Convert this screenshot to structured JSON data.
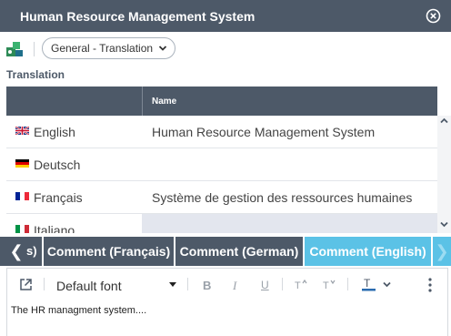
{
  "window": {
    "title": "Human Resource Management System"
  },
  "toolbar": {
    "view_selector": "General - Translation"
  },
  "translation": {
    "section_label": "Translation",
    "header_name": "Name",
    "rows": [
      {
        "flag": "uk-flag-icon",
        "language": "English",
        "value": "Human Resource Management System"
      },
      {
        "flag": "germany-flag-icon",
        "language": "Deutsch",
        "value": ""
      },
      {
        "flag": "france-flag-icon",
        "language": "Français",
        "value": "Système de gestion des ressources humaines"
      },
      {
        "flag": "italy-flag-icon",
        "language": "Italiano",
        "value": ""
      }
    ]
  },
  "tabs": {
    "partial_label": "s)",
    "items": [
      {
        "label": "Comment (Français)",
        "active": false
      },
      {
        "label": "Comment (German)",
        "active": false
      },
      {
        "label": "Comment (English)",
        "active": true
      }
    ]
  },
  "editor": {
    "font": "Default font",
    "buttons": [
      "B",
      "I",
      "U"
    ],
    "content": "The HR managment system...."
  },
  "colors": {
    "header": "#4d5968",
    "active_tab": "#5bc2e6",
    "blank_cell": "#e3e6ee"
  }
}
